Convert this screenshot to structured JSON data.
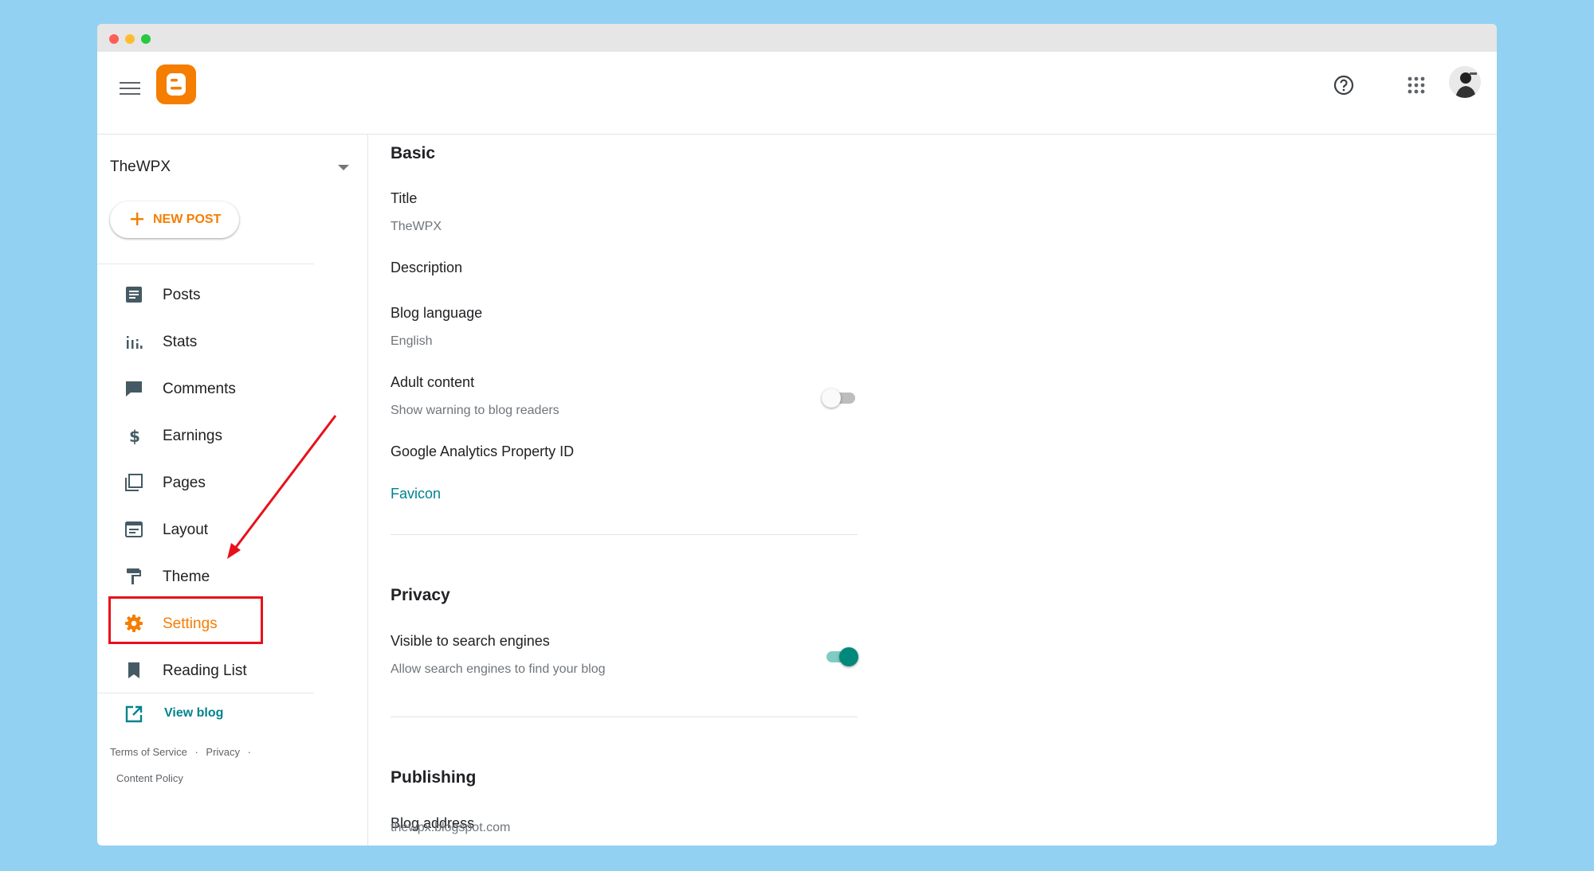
{
  "header": {
    "menu_icon": "hamburger-icon",
    "logo_icon": "blogger-logo-icon",
    "help_icon": "help-circle-icon",
    "apps_icon": "apps-grid-icon",
    "accent": "#f57d00"
  },
  "sidebar": {
    "blog_name": "TheWPX",
    "new_post_label": "NEW POST",
    "items": [
      {
        "label": "Posts",
        "icon": "posts-icon"
      },
      {
        "label": "Stats",
        "icon": "stats-icon"
      },
      {
        "label": "Comments",
        "icon": "comments-icon"
      },
      {
        "label": "Earnings",
        "icon": "dollar-icon"
      },
      {
        "label": "Pages",
        "icon": "pages-icon"
      },
      {
        "label": "Layout",
        "icon": "layout-icon"
      },
      {
        "label": "Theme",
        "icon": "paint-roller-icon"
      },
      {
        "label": "Settings",
        "icon": "gear-icon",
        "active": true
      },
      {
        "label": "Reading List",
        "icon": "bookmark-icon"
      }
    ],
    "view_blog_label": "View blog",
    "footer": {
      "terms": "Terms of Service",
      "privacy": "Privacy",
      "content_policy": "Content Policy",
      "separator": "·"
    }
  },
  "main": {
    "basic": {
      "title": "Basic",
      "title_label": "Title",
      "title_value": "TheWPX",
      "description_label": "Description",
      "language_label": "Blog language",
      "language_value": "English",
      "adult_label": "Adult content",
      "adult_desc": "Show warning to blog readers",
      "adult_enabled": false,
      "analytics_label": "Google Analytics Property ID",
      "favicon_label": "Favicon"
    },
    "privacy": {
      "title": "Privacy",
      "visible_label": "Visible to search engines",
      "visible_desc": "Allow search engines to find your blog",
      "visible_enabled": true
    },
    "publishing": {
      "title": "Publishing",
      "address_label": "Blog address",
      "address_value": "thewpx.blogspot.com"
    }
  },
  "colors": {
    "background": "#92d1f1",
    "accent": "#f57d00",
    "link": "#00838f",
    "toggle_on": "#00897b",
    "highlight": "#e8101a"
  }
}
